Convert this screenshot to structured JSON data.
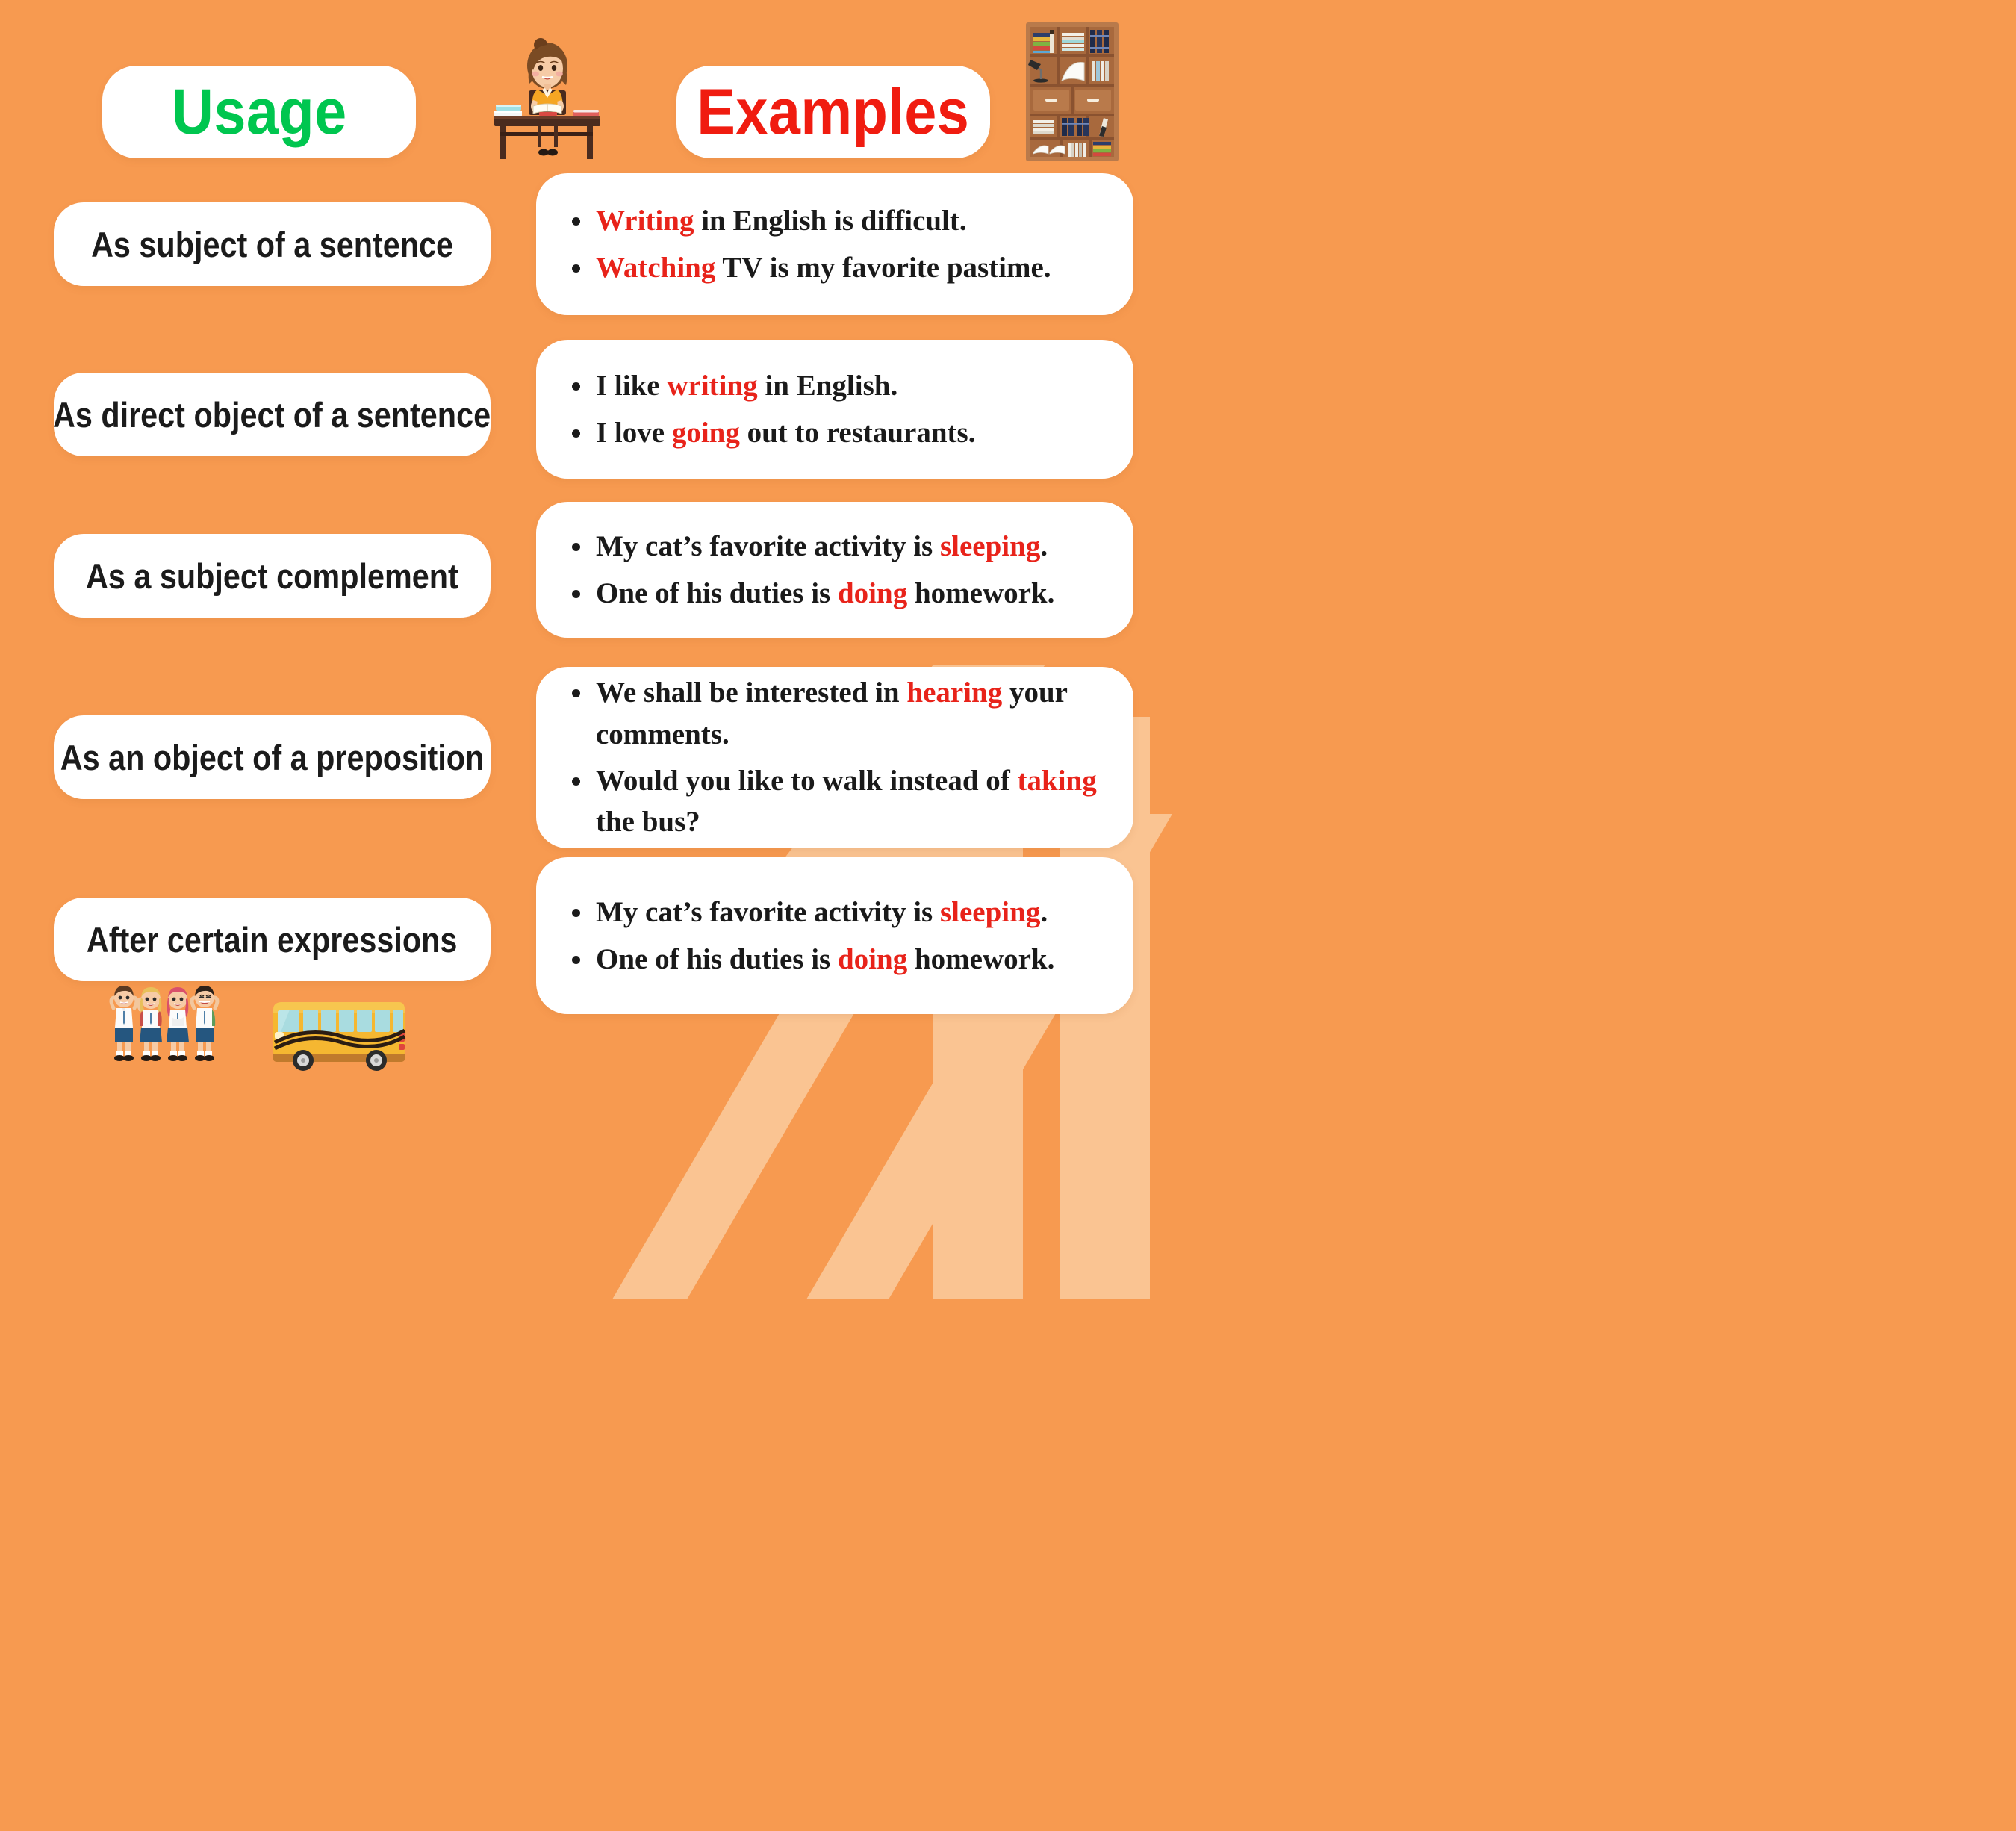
{
  "headers": {
    "usage": {
      "label": "Usage",
      "color": "#00C64F"
    },
    "examples": {
      "label": "Examples",
      "color": "#F01C10"
    }
  },
  "theme": {
    "background": "#F79A50",
    "card_background": "#FFFFFF",
    "highlight_color": "#E8231A",
    "body_text_color": "#1A1A1A"
  },
  "rows": [
    {
      "usage": "As subject of a sentence",
      "examples": [
        {
          "pre": "",
          "gerund": "Writing",
          "post": " in English is difficult."
        },
        {
          "pre": "",
          "gerund": "Watching",
          "post": " TV is my favorite pastime."
        }
      ]
    },
    {
      "usage": "As direct object of a sentence",
      "examples": [
        {
          "pre": "I like ",
          "gerund": "writing",
          "post": " in English."
        },
        {
          "pre": "I love ",
          "gerund": "going",
          "post": " out to restaurants."
        }
      ]
    },
    {
      "usage": "As a subject complement",
      "examples": [
        {
          "pre": "My cat’s favorite activity is ",
          "gerund": "sleeping",
          "post": "."
        },
        {
          "pre": "One of his duties is ",
          "gerund": "doing",
          "post": " homework."
        }
      ]
    },
    {
      "usage": "As an object of a preposition",
      "examples": [
        {
          "pre": "We shall be interested in ",
          "gerund": "hearing",
          "post": " your comments."
        },
        {
          "pre": "Would you like to walk instead of ",
          "gerund": "taking",
          "post": " the bus?"
        }
      ]
    },
    {
      "usage": "After certain expressions",
      "examples": [
        {
          "pre": "My cat’s favorite activity is ",
          "gerund": "sleeping",
          "post": "."
        },
        {
          "pre": "One of his duties is ",
          "gerund": "doing",
          "post": " homework."
        }
      ]
    }
  ],
  "illustrations": {
    "teacher": "girl-reading-at-desk-illustration",
    "bookshelf": "bookshelf-illustration",
    "kids": "school-children-waving-illustration",
    "bus": "school-bus-illustration"
  }
}
